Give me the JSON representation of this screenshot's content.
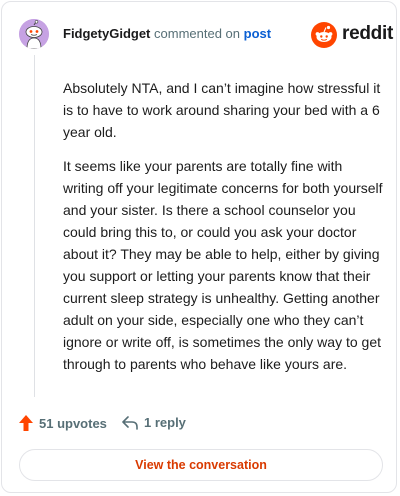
{
  "header": {
    "username": "FidgetyGidget",
    "action": "commented on",
    "link": "post"
  },
  "logo": {
    "wordmark": "reddit",
    "brand_color": "#ff4500"
  },
  "comment": {
    "paragraphs": [
      "Absolutely NTA, and I can’t imagine how stressful it is to have to work around sharing your bed with a 6 year old.",
      "It seems like your parents are totally fine with writing off your legitimate concerns for both yourself and your sister. Is there a school counselor you could bring this to, or could you ask your doctor about it? They may be able to help, either by giving you support or letting your parents know that their current sleep strategy is unhealthy. Getting another adult on your side, especially one who they can’t ignore or write off, is sometimes the only way to get through to parents who behave like yours are."
    ]
  },
  "footer": {
    "upvotes": "51 upvotes",
    "replies": "1 reply",
    "upvote_icon": "upvote-arrow-icon",
    "reply_icon": "reply-arrow-icon",
    "upvote_color": "#ff4500"
  },
  "cta": {
    "label": "View the conversation",
    "color": "#d93a00"
  }
}
